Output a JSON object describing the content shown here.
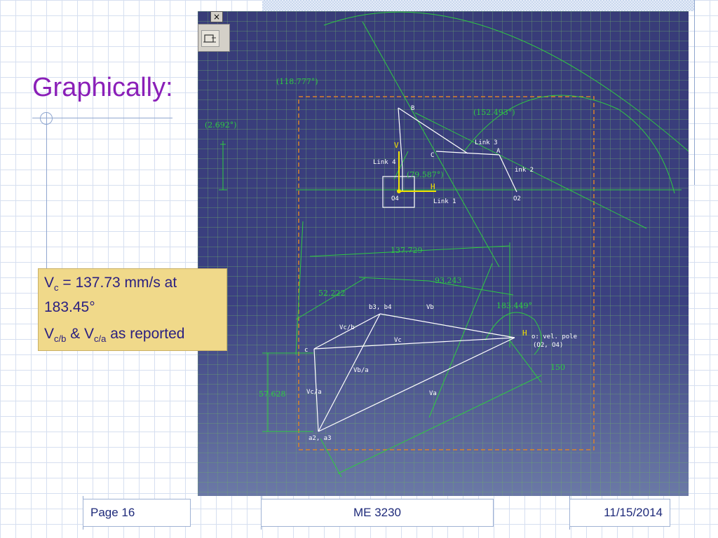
{
  "slide": {
    "title": "Graphically:",
    "callout": {
      "line1_prefix": "V",
      "line1_sub": "c",
      "line1_rest": " = 137.73 mm/s at",
      "line2": "183.45°",
      "line3_v1": "V",
      "line3_sub1": "c/b",
      "line3_mid": " & V",
      "line3_sub2": "c/a",
      "line3_rest": " as reported"
    },
    "footer": {
      "page": "Page 16",
      "course": "ME 3230",
      "date": "11/15/2014"
    }
  },
  "cad": {
    "close_glyph": "×",
    "toolbar_icon": "sketch-icon",
    "colors": {
      "background": "#373e77",
      "grid": "#6eaa6e",
      "dimension": "#2ecc40",
      "geometry": "#ffffff",
      "frame": "#d9822b",
      "axis": "#f2e200"
    },
    "dims": {
      "d_118": "(118.777°)",
      "d_152": "(152.493°)",
      "d_2692": "(2.692°)",
      "d_79": "(79.587°)",
      "d_137": "137.729",
      "d_93": "93.243",
      "d_52": "52.222",
      "d_183": "183.449°",
      "d_57": "57.628",
      "d_150": "150"
    },
    "labels": {
      "B": "B",
      "A": "A",
      "C": "C",
      "O4": "O4",
      "O2": "O2",
      "link1": "Link 1",
      "link2": "ink 2",
      "link3": "Link 3",
      "link4": "Link 4",
      "V": "V",
      "H": "H",
      "b3b4": "b3, b4",
      "vb": "Vb",
      "c": "c",
      "vcb": "Vc/b",
      "vc": "Vc",
      "vba": "Vb/a",
      "vca": "Vc/a",
      "va": "Va",
      "a2a3": "a2, a3",
      "pole1": "o: vel. pole",
      "pole2": "(O2, O4)"
    }
  }
}
